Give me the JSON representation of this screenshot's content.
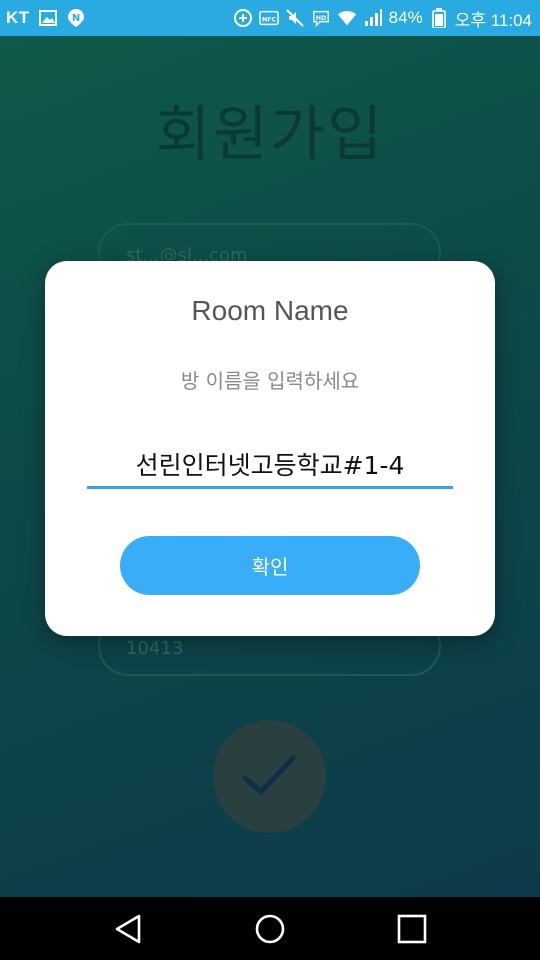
{
  "status_bar": {
    "carrier": "KT",
    "battery": "84%",
    "time": "오후 11:04",
    "icons": [
      "gallery-icon",
      "naver-icon",
      "data-saver-icon",
      "nfc-icon",
      "mute-icon",
      "hd-voice-icon",
      "wifi-icon",
      "signal-icon",
      "battery-icon"
    ],
    "nfc_label": "NFC",
    "hd_label": "HD"
  },
  "background": {
    "title": "회원가입",
    "field1_text": "st...@sl...com",
    "field2_text": "10413"
  },
  "dialog": {
    "title": "Room Name",
    "message": "방 이름을 입력하세요",
    "input_value": "선린인터넷고등학교#1-4",
    "confirm_label": "확인"
  },
  "nav_bar": {
    "icons": [
      "back-icon",
      "home-icon",
      "recent-apps-icon"
    ]
  },
  "colors": {
    "status_bar": "#29abe2",
    "accent": "#39adf7",
    "input_underline": "#3aa3e6"
  }
}
